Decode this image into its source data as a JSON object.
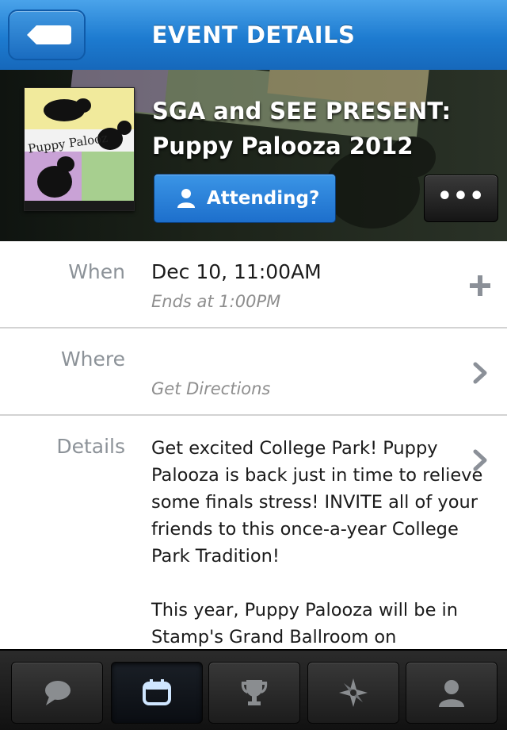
{
  "header": {
    "title": "EVENT DETAILS",
    "back_icon": "back-arrow-icon"
  },
  "event": {
    "title_line1": "SGA and SEE PRESENT:",
    "title_line2": "Puppy Palooza 2012",
    "thumbnail_text": "Puppy Palooz",
    "attend_label": "Attending?",
    "more_label": "•••"
  },
  "when": {
    "label": "When",
    "value": "Dec 10, 11:00AM",
    "sub": "Ends at 1:00PM"
  },
  "where": {
    "label": "Where",
    "value": "",
    "sub": "Get Directions"
  },
  "details": {
    "label": "Details",
    "text": "Get excited College Park! Puppy Palooza is back just in time to relieve some finals stress! INVITE all of your friends to this once-a-year College Park Tradition!\n\nThis year, Puppy Palooza will be in Stamp's Grand Ballroom on"
  },
  "tabs": [
    {
      "name": "chat-icon",
      "active": false
    },
    {
      "name": "calendar-icon",
      "active": true
    },
    {
      "name": "trophy-icon",
      "active": false
    },
    {
      "name": "compass-icon",
      "active": false
    },
    {
      "name": "profile-icon",
      "active": false
    }
  ],
  "colors": {
    "accent": "#1d7bd0",
    "label_gray": "#8c9298"
  }
}
